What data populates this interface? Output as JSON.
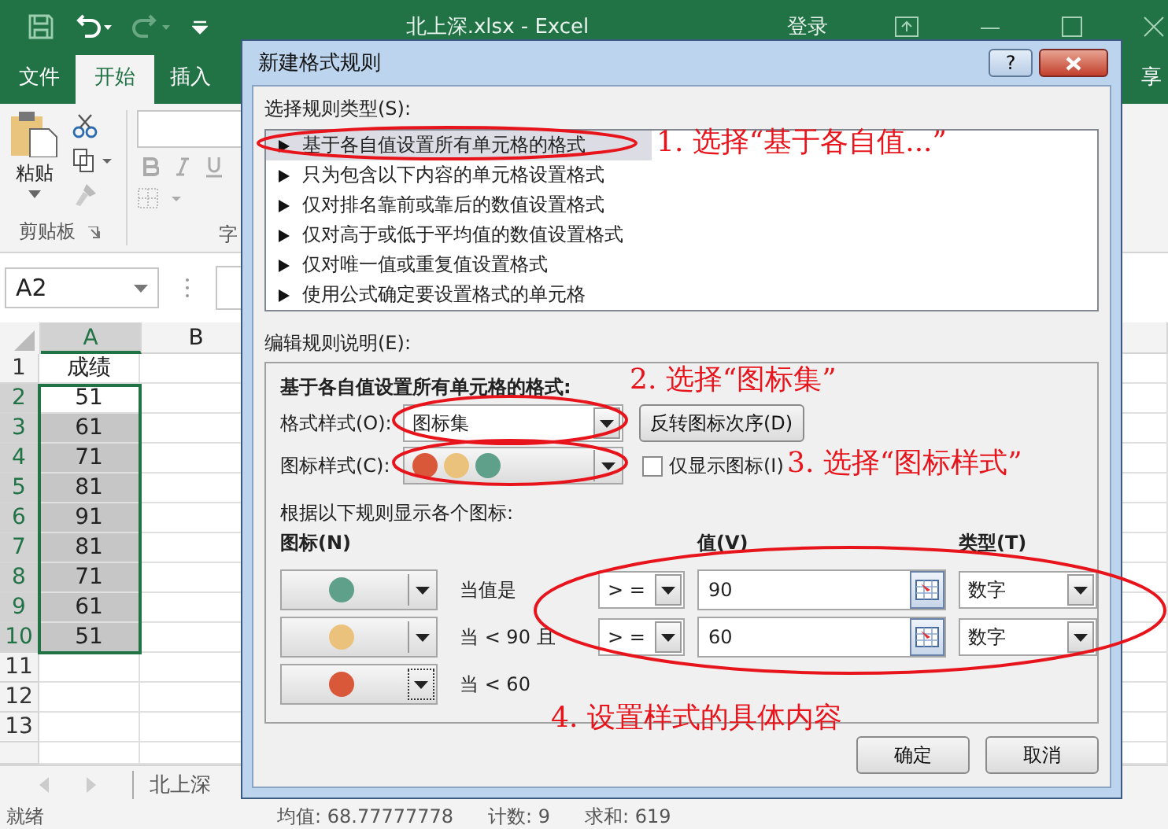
{
  "titlebar": {
    "title": "北上深.xlsx - Excel",
    "sign_in": "登录"
  },
  "ribbon": {
    "tabs": [
      {
        "label": "文件",
        "selected": false
      },
      {
        "label": "开始",
        "selected": true
      },
      {
        "label": "插入",
        "selected": false
      }
    ],
    "tab_cut": "享",
    "paste": "粘贴",
    "clipboard_group": "剪贴板",
    "font_group_cut": "字"
  },
  "name_box": "A2",
  "sheet": {
    "columns": [
      "A",
      "B"
    ],
    "rows": [
      {
        "number": "1",
        "value": "成绩",
        "selected": false
      },
      {
        "number": "2",
        "value": "51",
        "selected": true,
        "active": true
      },
      {
        "number": "3",
        "value": "61",
        "selected": true,
        "active": false
      },
      {
        "number": "4",
        "value": "71",
        "selected": true,
        "active": false
      },
      {
        "number": "5",
        "value": "81",
        "selected": true,
        "active": false
      },
      {
        "number": "6",
        "value": "91",
        "selected": true,
        "active": false
      },
      {
        "number": "7",
        "value": "81",
        "selected": true,
        "active": false
      },
      {
        "number": "8",
        "value": "71",
        "selected": true,
        "active": false
      },
      {
        "number": "9",
        "value": "61",
        "selected": true,
        "active": false
      },
      {
        "number": "10",
        "value": "51",
        "selected": true,
        "active": false
      },
      {
        "number": "11",
        "value": "",
        "selected": false
      },
      {
        "number": "12",
        "value": "",
        "selected": false
      },
      {
        "number": "13",
        "value": "",
        "selected": false
      }
    ],
    "tab": "北上深"
  },
  "status_bar": {
    "ready": "就绪",
    "stats": [
      "均值: 68.77777778",
      "计数: 9",
      "求和: 619"
    ]
  },
  "dialog": {
    "title": "新建格式规则",
    "help": "?",
    "rule_type_label": "选择规则类型(S):",
    "rule_types": [
      {
        "label": "基于各自值设置所有单元格的格式",
        "selected": true
      },
      {
        "label": "只为包含以下内容的单元格设置格式",
        "selected": false
      },
      {
        "label": "仅对排名靠前或靠后的数值设置格式",
        "selected": false
      },
      {
        "label": "仅对高于或低于平均值的数值设置格式",
        "selected": false
      },
      {
        "label": "仅对唯一值或重复值设置格式",
        "selected": false
      },
      {
        "label": "使用公式确定要设置格式的单元格",
        "selected": false
      }
    ],
    "description_label": "编辑规则说明(E):",
    "panel": {
      "heading": "基于各自值设置所有单元格的格式:",
      "format_style_label": "格式样式(O):",
      "format_style": "图标集",
      "reverse_button": "反转图标次序(D)",
      "icon_style_label": "图标样式(C):",
      "icon_style_circles": [
        {
          "color": "#d9583a"
        },
        {
          "color": "#ebc27c"
        },
        {
          "color": "#5fa08a"
        }
      ],
      "show_icon_only": {
        "label": "仅显示图标(I)",
        "checked": false
      },
      "rules_caption": "根据以下规则显示各个图标:",
      "headers": {
        "icon": "图标(N)",
        "value": "值(V)",
        "type": "类型(T)"
      },
      "rules": [
        {
          "color": "#5fa08a",
          "condition": "当值是",
          "operator": "> =",
          "value": "90",
          "type": "数字"
        },
        {
          "color": "#ebc27c",
          "condition": "当 < 90 且",
          "operator": "> =",
          "value": "60",
          "type": "数字"
        },
        {
          "color": "#d9583a",
          "condition": "当 < 60"
        }
      ]
    },
    "buttons": [
      "确定",
      "取消"
    ]
  },
  "annotations": [
    {
      "text": "1. 选择“基于各自值...”"
    },
    {
      "text": "2. 选择“图标集”"
    },
    {
      "text": "3. 选择“图标样式”"
    },
    {
      "text": "4. 设置样式的具体内容"
    }
  ]
}
